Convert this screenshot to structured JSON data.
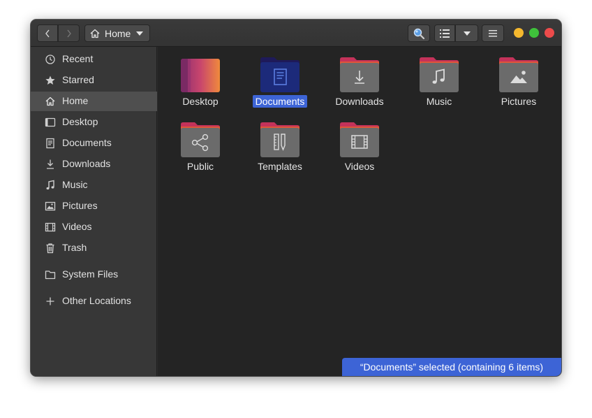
{
  "header": {
    "path_label": "Home"
  },
  "sidebar": {
    "items": [
      {
        "label": "Recent",
        "icon": "clock-icon"
      },
      {
        "label": "Starred",
        "icon": "star-icon"
      },
      {
        "label": "Home",
        "icon": "home-icon",
        "active": true
      },
      {
        "label": "Desktop",
        "icon": "desktop-icon"
      },
      {
        "label": "Documents",
        "icon": "document-icon"
      },
      {
        "label": "Downloads",
        "icon": "download-icon"
      },
      {
        "label": "Music",
        "icon": "music-icon"
      },
      {
        "label": "Pictures",
        "icon": "picture-icon"
      },
      {
        "label": "Videos",
        "icon": "video-icon"
      },
      {
        "label": "Trash",
        "icon": "trash-icon"
      },
      {
        "label": "System Files",
        "icon": "folder-icon"
      },
      {
        "label": "Other Locations",
        "icon": "plus-icon"
      }
    ]
  },
  "content": {
    "folders": [
      {
        "label": "Desktop",
        "icon": "desktop-folder-icon"
      },
      {
        "label": "Documents",
        "icon": "documents-folder-icon",
        "selected": true
      },
      {
        "label": "Downloads",
        "icon": "downloads-folder-icon"
      },
      {
        "label": "Music",
        "icon": "music-folder-icon"
      },
      {
        "label": "Pictures",
        "icon": "pictures-folder-icon"
      },
      {
        "label": "Public",
        "icon": "public-folder-icon"
      },
      {
        "label": "Templates",
        "icon": "templates-folder-icon"
      },
      {
        "label": "Videos",
        "icon": "videos-folder-icon"
      }
    ]
  },
  "status": {
    "text": "“Documents” selected  (containing 6 items)"
  },
  "colors": {
    "accent": "#3d64d6",
    "folder_tab": "#c4325a",
    "folder_body": "#6b6b6b",
    "window_min": "#f5b82e",
    "window_max": "#3fc23b",
    "window_close": "#ed4b4b"
  }
}
